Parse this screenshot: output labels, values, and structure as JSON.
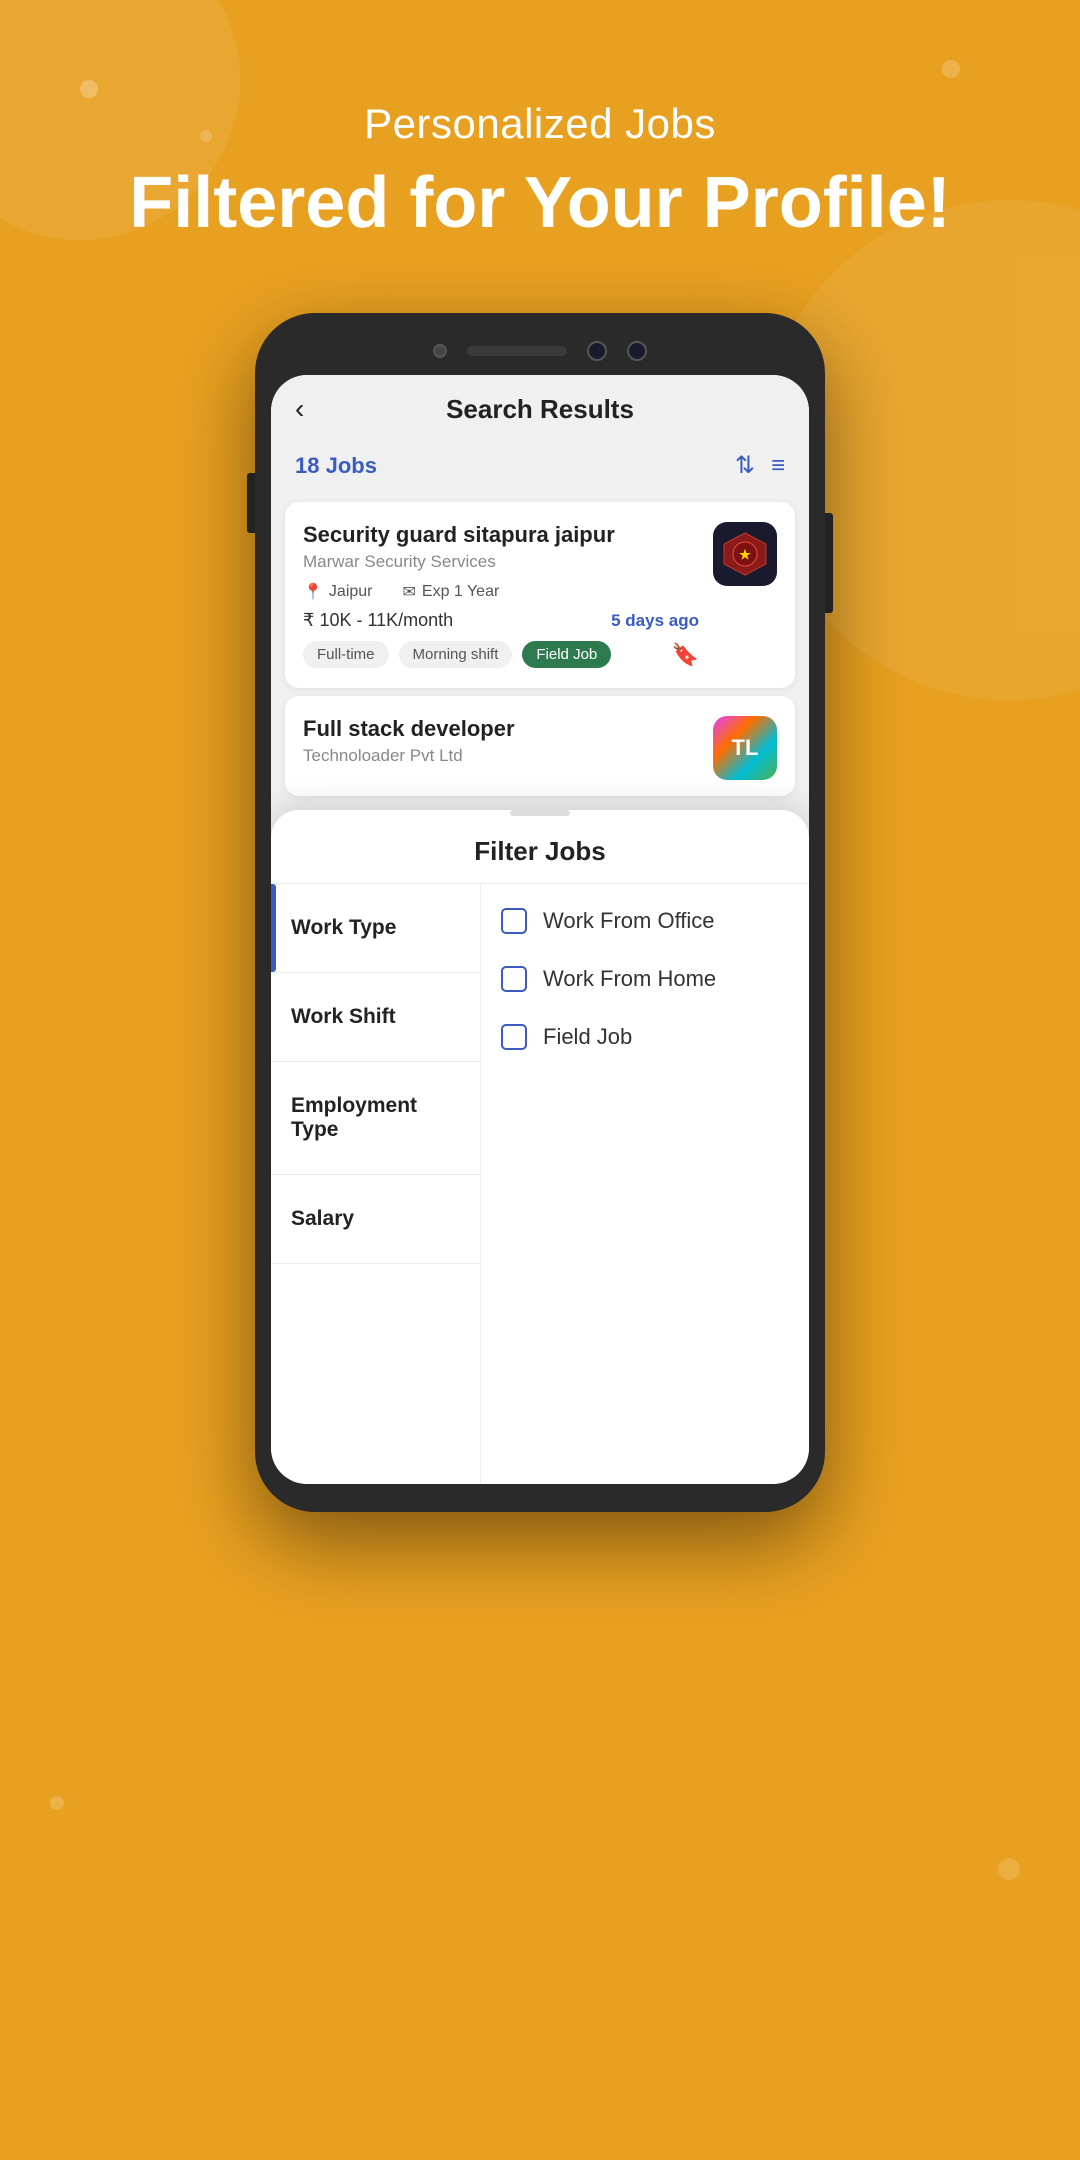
{
  "background": {
    "color": "#E8A020"
  },
  "header": {
    "subtitle": "Personalized Jobs",
    "title": "Filtered for Your Profile!"
  },
  "app": {
    "topbar_title": "Search Results",
    "back_label": "‹",
    "results_count": "18 Jobs"
  },
  "job_cards": [
    {
      "title": "Security guard sitapura jaipur",
      "company": "Marwar Security Services",
      "location": "Jaipur",
      "experience": "Exp 1 Year",
      "salary": "₹  10K - 11K/month",
      "days_ago": "5 days ago",
      "tags": [
        "Full-time",
        "Morning shift",
        "Field Job"
      ],
      "field_job_tag": true
    },
    {
      "title": "Full stack developer",
      "company": "Technoloader Pvt Ltd"
    }
  ],
  "filter_sheet": {
    "title": "Filter Jobs",
    "sidebar_items": [
      {
        "label": "Work Type",
        "active": true
      },
      {
        "label": "Work Shift",
        "active": false
      },
      {
        "label": "Employment Type",
        "active": false
      },
      {
        "label": "Salary",
        "active": false
      }
    ],
    "work_type_options": [
      {
        "label": "Work From Office",
        "checked": false
      },
      {
        "label": "Work From Home",
        "checked": false
      },
      {
        "label": "Field Job",
        "checked": false
      }
    ]
  }
}
